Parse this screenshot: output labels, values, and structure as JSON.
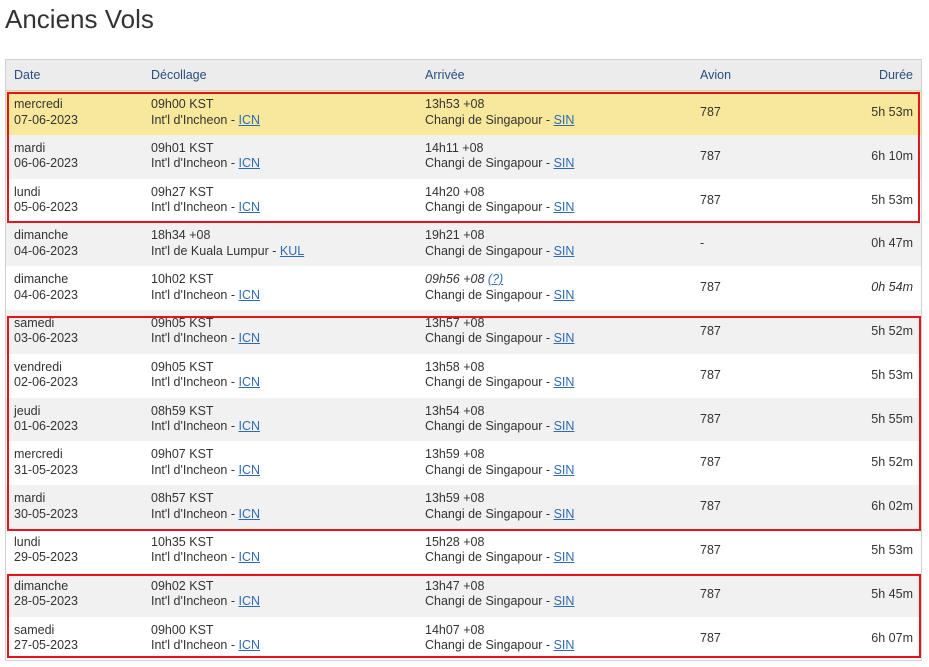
{
  "page": {
    "title": "Anciens Vols"
  },
  "table": {
    "headers": {
      "date": "Date",
      "departure": "Décollage",
      "arrival": "Arrivée",
      "aircraft": "Avion",
      "duration": "Durée"
    },
    "rows": [
      {
        "day": "mercredi",
        "date": "07-06-2023",
        "dep_time": "09h00 KST",
        "dep_airport": "Int'l d'Incheon - ",
        "dep_code": "ICN",
        "arr_time": "13h53 +08",
        "arr_airport": "Changi de Singapour - ",
        "arr_code": "SIN",
        "aircraft": "787",
        "duration": "5h 53m"
      },
      {
        "day": "mardi",
        "date": "06-06-2023",
        "dep_time": "09h01 KST",
        "dep_airport": "Int'l d'Incheon - ",
        "dep_code": "ICN",
        "arr_time": "14h11 +08",
        "arr_airport": "Changi de Singapour - ",
        "arr_code": "SIN",
        "aircraft": "787",
        "duration": "6h 10m"
      },
      {
        "day": "lundi",
        "date": "05-06-2023",
        "dep_time": "09h27 KST",
        "dep_airport": "Int'l d'Incheon - ",
        "dep_code": "ICN",
        "arr_time": "14h20 +08",
        "arr_airport": "Changi de Singapour - ",
        "arr_code": "SIN",
        "aircraft": "787",
        "duration": "5h 53m"
      },
      {
        "day": "dimanche",
        "date": "04-06-2023",
        "dep_time": "18h34 +08",
        "dep_airport": "Int'l de Kuala Lumpur - ",
        "dep_code": "KUL",
        "arr_time": "19h21 +08",
        "arr_airport": "Changi de Singapour - ",
        "arr_code": "SIN",
        "aircraft": "-",
        "duration": "0h 47m"
      },
      {
        "day": "dimanche",
        "date": "04-06-2023",
        "dep_time": "10h02 KST",
        "dep_airport": "Int'l d'Incheon - ",
        "dep_code": "ICN",
        "arr_time": "09h56 +08",
        "arr_note": "(?)",
        "arr_airport": "Changi de Singapour - ",
        "arr_code": "SIN",
        "aircraft": "787",
        "duration": "0h 54m"
      },
      {
        "day": "samedi",
        "date": "03-06-2023",
        "dep_time": "09h05 KST",
        "dep_airport": "Int'l d'Incheon - ",
        "dep_code": "ICN",
        "arr_time": "13h57 +08",
        "arr_airport": "Changi de Singapour - ",
        "arr_code": "SIN",
        "aircraft": "787",
        "duration": "5h 52m"
      },
      {
        "day": "vendredi",
        "date": "02-06-2023",
        "dep_time": "09h05 KST",
        "dep_airport": "Int'l d'Incheon - ",
        "dep_code": "ICN",
        "arr_time": "13h58 +08",
        "arr_airport": "Changi de Singapour - ",
        "arr_code": "SIN",
        "aircraft": "787",
        "duration": "5h 53m"
      },
      {
        "day": "jeudi",
        "date": "01-06-2023",
        "dep_time": "08h59 KST",
        "dep_airport": "Int'l d'Incheon - ",
        "dep_code": "ICN",
        "arr_time": "13h54 +08",
        "arr_airport": "Changi de Singapour - ",
        "arr_code": "SIN",
        "aircraft": "787",
        "duration": "5h 55m"
      },
      {
        "day": "mercredi",
        "date": "31-05-2023",
        "dep_time": "09h07 KST",
        "dep_airport": "Int'l d'Incheon - ",
        "dep_code": "ICN",
        "arr_time": "13h59 +08",
        "arr_airport": "Changi de Singapour - ",
        "arr_code": "SIN",
        "aircraft": "787",
        "duration": "5h 52m"
      },
      {
        "day": "mardi",
        "date": "30-05-2023",
        "dep_time": "08h57 KST",
        "dep_airport": "Int'l d'Incheon - ",
        "dep_code": "ICN",
        "arr_time": "13h59 +08",
        "arr_airport": "Changi de Singapour - ",
        "arr_code": "SIN",
        "aircraft": "787",
        "duration": "6h 02m"
      },
      {
        "day": "lundi",
        "date": "29-05-2023",
        "dep_time": "10h35 KST",
        "dep_airport": "Int'l d'Incheon - ",
        "dep_code": "ICN",
        "arr_time": "15h28 +08",
        "arr_airport": "Changi de Singapour - ",
        "arr_code": "SIN",
        "aircraft": "787",
        "duration": "5h 53m"
      },
      {
        "day": "dimanche",
        "date": "28-05-2023",
        "dep_time": "09h02 KST",
        "dep_airport": "Int'l d'Incheon - ",
        "dep_code": "ICN",
        "arr_time": "13h47 +08",
        "arr_airport": "Changi de Singapour - ",
        "arr_code": "SIN",
        "aircraft": "787",
        "duration": "5h 45m"
      },
      {
        "day": "samedi",
        "date": "27-05-2023",
        "dep_time": "09h00 KST",
        "dep_airport": "Int'l d'Incheon - ",
        "dep_code": "ICN",
        "arr_time": "14h07 +08",
        "arr_airport": "Changi de Singapour - ",
        "arr_code": "SIN",
        "aircraft": "787",
        "duration": "6h 07m"
      }
    ]
  },
  "colors": {
    "highlight_row": "#f8e89b",
    "link": "#2f6bb5",
    "selection_box": "#e8121b",
    "header_text": "#2a4e7f"
  }
}
